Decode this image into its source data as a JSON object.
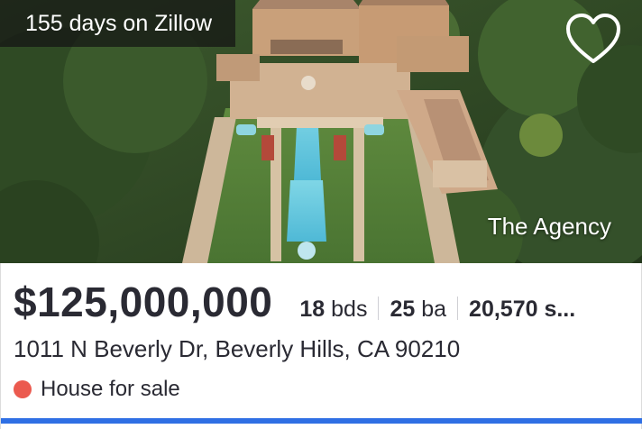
{
  "listing": {
    "days_on_site": "155 days on Zillow",
    "brokerage": "The Agency",
    "price": "$125,000,000",
    "beds_value": "18",
    "beds_unit": "bds",
    "baths_value": "25",
    "baths_unit": "ba",
    "sqft_text": "20,570 s...",
    "address": "1011 N Beverly Dr, Beverly Hills, CA 90210",
    "status": "House for sale"
  },
  "colors": {
    "status_dot": "#eb5a4f",
    "accent_bar": "#2f6fe4",
    "text": "#2a2a33"
  },
  "icons": {
    "favorite": "heart-outline-icon",
    "status": "status-dot-icon"
  }
}
